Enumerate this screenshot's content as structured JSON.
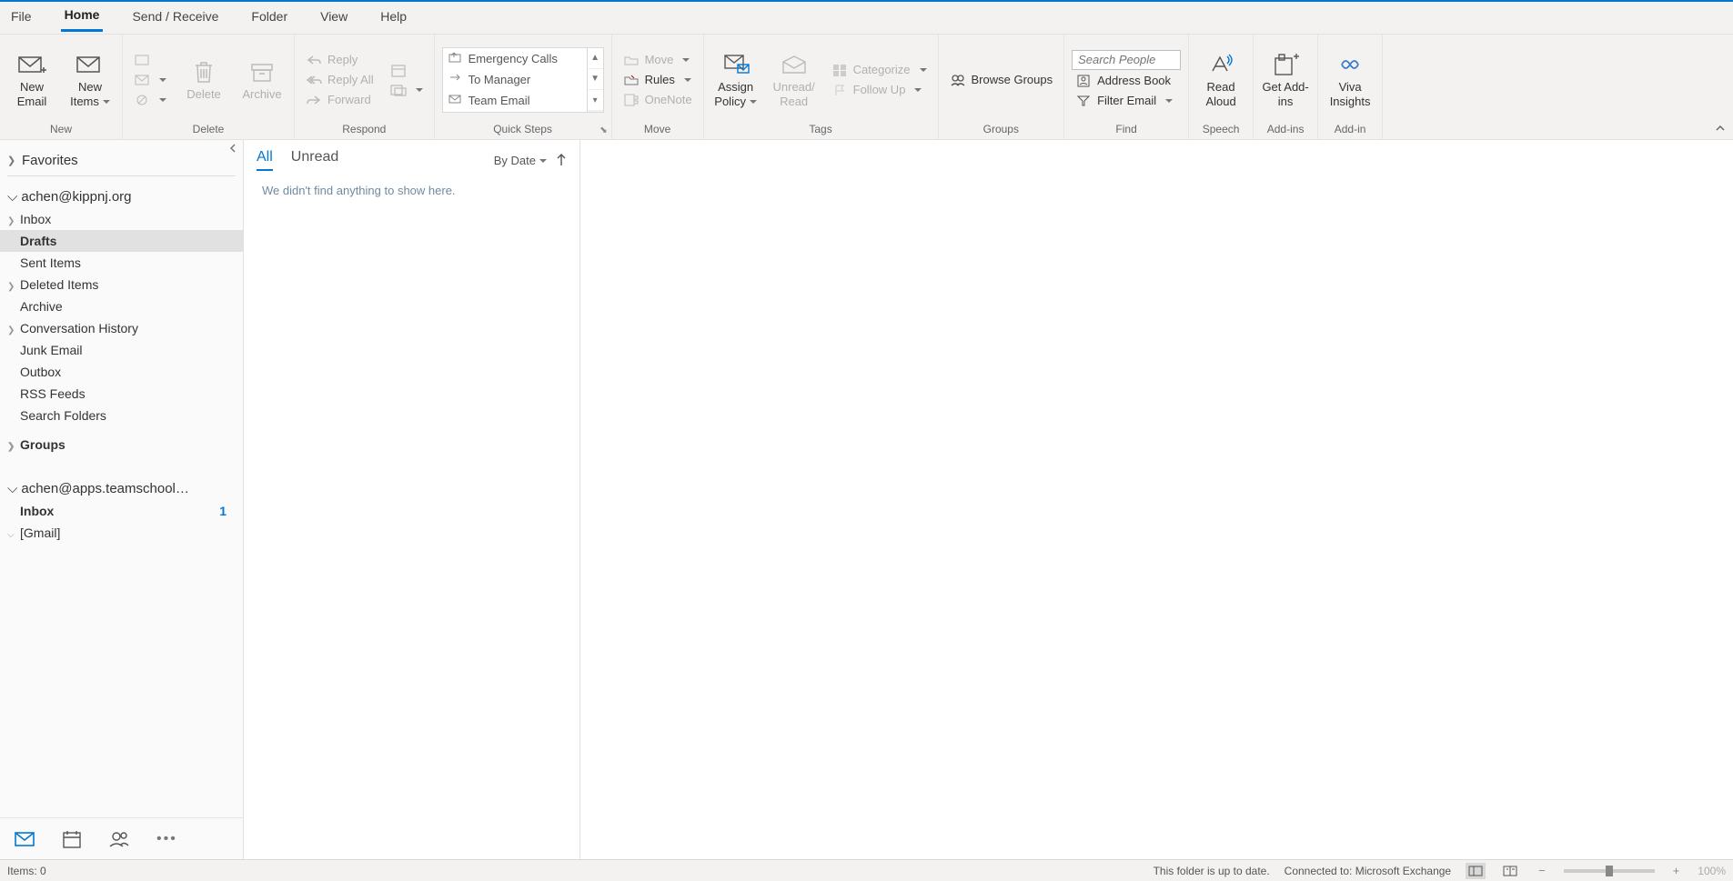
{
  "menu": {
    "tabs": [
      "File",
      "Home",
      "Send / Receive",
      "Folder",
      "View",
      "Help"
    ],
    "active": "Home"
  },
  "ribbon": {
    "new": {
      "label": "New",
      "newEmail": "New Email",
      "newItems": "New Items"
    },
    "delete": {
      "label": "Delete",
      "delete": "Delete",
      "archive": "Archive"
    },
    "respond": {
      "label": "Respond",
      "reply": "Reply",
      "replyAll": "Reply All",
      "forward": "Forward"
    },
    "quickSteps": {
      "label": "Quick Steps",
      "emergency": "Emergency Calls",
      "toManager": "To Manager",
      "teamEmail": "Team Email"
    },
    "move": {
      "label": "Move",
      "move": "Move",
      "rules": "Rules",
      "onenote": "OneNote"
    },
    "tags": {
      "label": "Tags",
      "assignPolicy": "Assign Policy",
      "unreadRead": "Unread/ Read",
      "categorize": "Categorize",
      "followUp": "Follow Up"
    },
    "groups": {
      "label": "Groups",
      "browseGroups": "Browse Groups"
    },
    "find": {
      "label": "Find",
      "searchPlaceholder": "Search People",
      "addressBook": "Address Book",
      "filterEmail": "Filter Email"
    },
    "speech": {
      "label": "Speech",
      "readAloud": "Read Aloud"
    },
    "addins": {
      "label": "Add-ins",
      "getAddins": "Get Add-ins"
    },
    "addin": {
      "label": "Add-in",
      "vivaInsights": "Viva Insights"
    }
  },
  "sidebar": {
    "favorites": "Favorites",
    "accounts": [
      {
        "name": "achen@kippnj.org",
        "expanded": true,
        "folders": [
          {
            "name": "Inbox",
            "expandable": true
          },
          {
            "name": "Drafts",
            "selected": true,
            "bold": true
          },
          {
            "name": "Sent Items"
          },
          {
            "name": "Deleted Items",
            "expandable": true
          },
          {
            "name": "Archive"
          },
          {
            "name": "Conversation History",
            "expandable": true
          },
          {
            "name": "Junk Email"
          },
          {
            "name": "Outbox"
          },
          {
            "name": "RSS Feeds"
          },
          {
            "name": "Search Folders"
          }
        ],
        "groups": "Groups"
      },
      {
        "name": "achen@apps.teamschool…",
        "expanded": true,
        "folders": [
          {
            "name": "Inbox",
            "count": "1"
          },
          {
            "name": "[Gmail]",
            "expandable": true,
            "chev": "down"
          }
        ]
      }
    ]
  },
  "msgList": {
    "all": "All",
    "unread": "Unread",
    "sort": "By Date",
    "empty": "We didn't find anything to show here."
  },
  "status": {
    "items": "Items: 0",
    "folderStatus": "This folder is up to date.",
    "connection": "Connected to: Microsoft Exchange",
    "zoom": "100%"
  }
}
